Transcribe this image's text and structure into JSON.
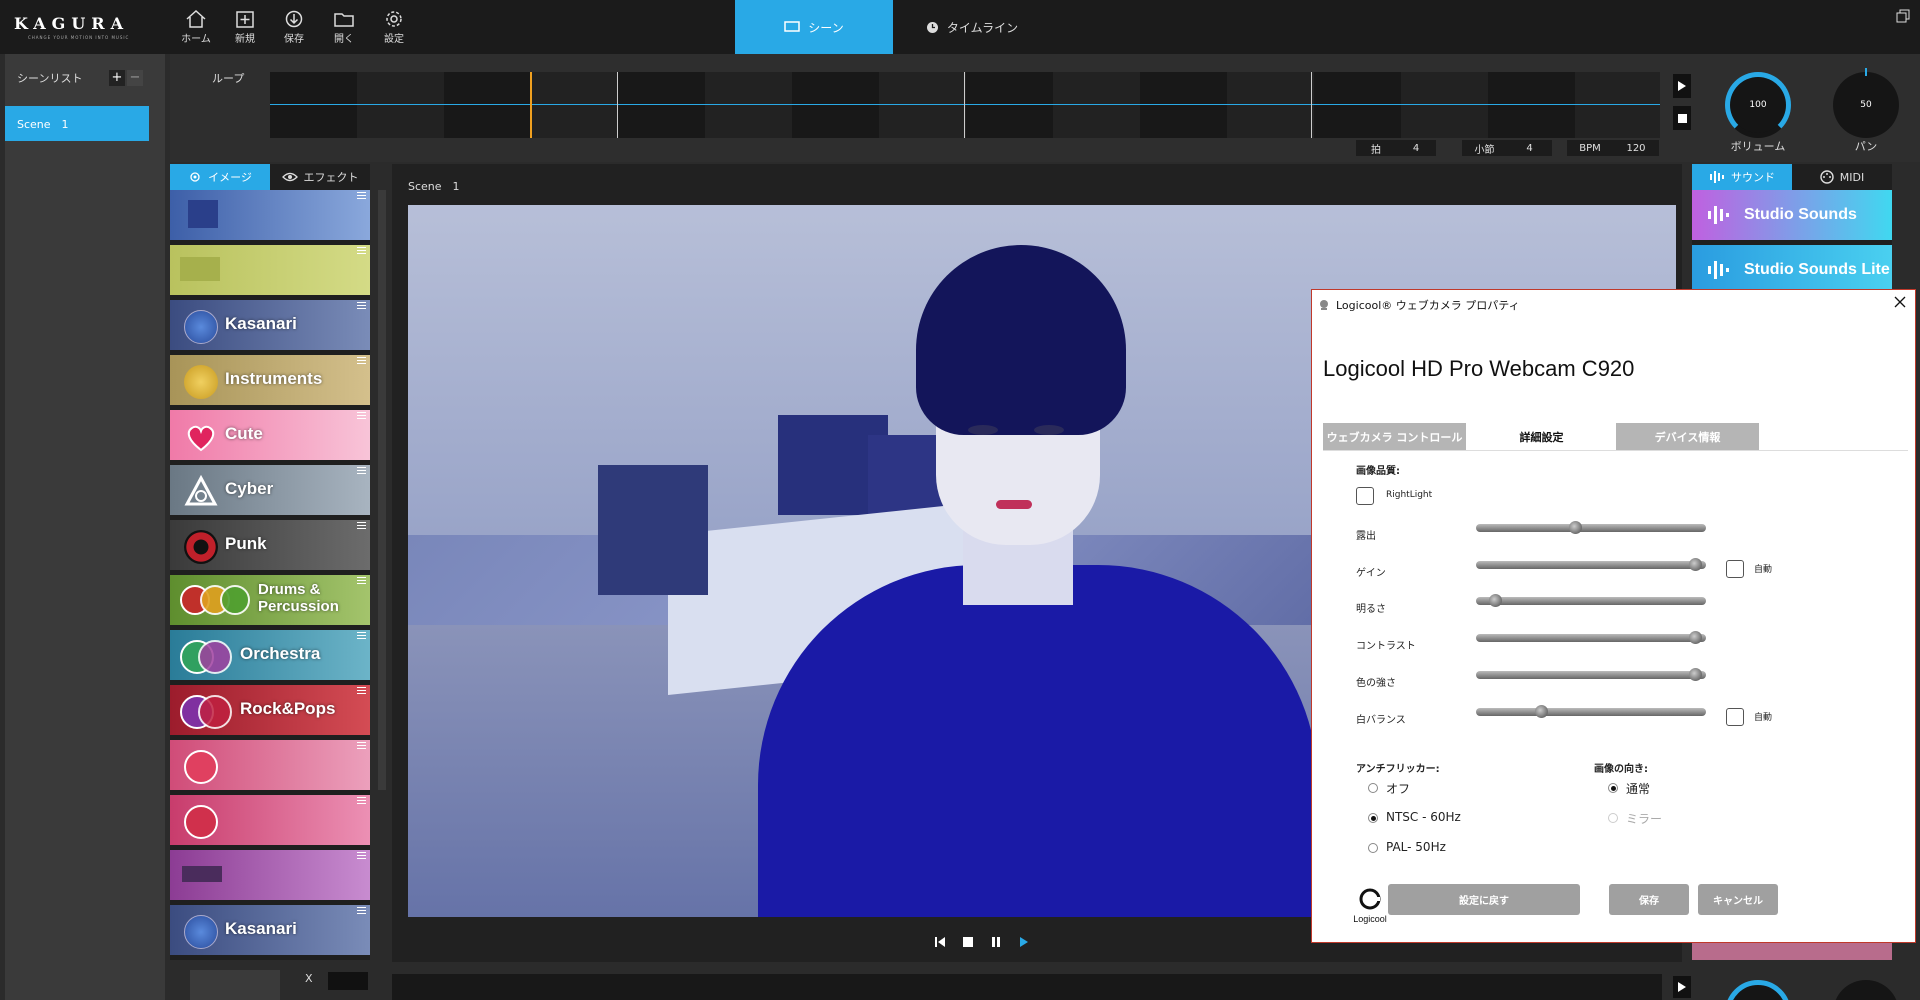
{
  "app": {
    "logo_text": "KAGURA",
    "logo_tagline": "CHANGE YOUR MOTION INTO MUSIC",
    "toolbar": [
      {
        "label": "ホーム",
        "icon": "home-icon"
      },
      {
        "label": "新規",
        "icon": "new-icon"
      },
      {
        "label": "保存",
        "icon": "save-icon"
      },
      {
        "label": "開く",
        "icon": "folder-icon"
      },
      {
        "label": "設定",
        "icon": "gear-icon"
      }
    ],
    "tabs": {
      "scene": "シーン",
      "timeline": "タイムライン"
    },
    "accent": "#29a9e6"
  },
  "scenelist": {
    "title": "シーンリスト",
    "items": [
      "Scene　1"
    ]
  },
  "loop": {
    "label": "ループ",
    "beat_label": "拍",
    "beat_value": "4",
    "measure_label": "小節",
    "measure_value": "4",
    "bpm_label": "BPM",
    "bpm_value": "120"
  },
  "knobs": {
    "volume_value": "100",
    "volume_label": "ボリューム",
    "volume_level": 1.0,
    "pan_value": "50",
    "pan_label": "パン",
    "pan_level": 0.5
  },
  "imagetabs": {
    "image": "イメージ",
    "effect": "エフェクト"
  },
  "image_tiles": [
    {
      "label": "",
      "bg": "#5a80c6"
    },
    {
      "label": "",
      "bg": "#b8c460"
    },
    {
      "label": "Kasanari",
      "bg": "#4a5a8c"
    },
    {
      "label": "Instruments",
      "bg": "#b8a46c"
    },
    {
      "label": "Cute",
      "bg": "#f4a2c0"
    },
    {
      "label": "Cyber",
      "bg": "#7c8894"
    },
    {
      "label": "Punk",
      "bg": "#4a4a4a"
    },
    {
      "label": "Drums &",
      "label2": "Percussion",
      "bg": "#7ca43c"
    },
    {
      "label": "Orchestra",
      "bg": "#3c8ca4"
    },
    {
      "label": "Rock&Pops",
      "bg": "#b02c34"
    },
    {
      "label": "",
      "bg": "#d85c84"
    },
    {
      "label": "",
      "bg": "#d8507c"
    },
    {
      "label": "",
      "bg": "#a458a4"
    },
    {
      "label": "Kasanari",
      "bg": "#4a5a8c"
    }
  ],
  "preview": {
    "scene_title": "Scene　1"
  },
  "soundtabs": {
    "sound": "サウンド",
    "midi": "MIDI"
  },
  "sound_tiles": [
    "Studio Sounds",
    "Studio Sounds Lite"
  ],
  "bottom": {
    "x_label": "X"
  },
  "dialog": {
    "title": "Logicool® ウェブカメラ プロパティ",
    "heading": "Logicool HD Pro Webcam C920",
    "tabs": [
      "ウェブカメラ コントロール",
      "詳細設定",
      "デバイス情報"
    ],
    "active_tab": "詳細設定",
    "quality_label": "画像品質:",
    "rightlight_label": "RightLight",
    "sliders": [
      {
        "label": "露出",
        "value": 0.43,
        "auto": false
      },
      {
        "label": "ゲイン",
        "value": 0.98,
        "auto": true
      },
      {
        "label": "明るさ",
        "value": 0.06,
        "auto": false
      },
      {
        "label": "コントラスト",
        "value": 0.98,
        "auto": false
      },
      {
        "label": "色の強さ",
        "value": 0.98,
        "auto": false
      },
      {
        "label": "白バランス",
        "value": 0.27,
        "auto": true
      }
    ],
    "auto_label": "自動",
    "antiflicker_label": "アンチフリッカー:",
    "antiflicker_options": [
      "オフ",
      "NTSC - 60Hz",
      "PAL- 50Hz"
    ],
    "antiflicker_selected": "NTSC - 60Hz",
    "orientation_label": "画像の向き:",
    "orientation_options": [
      "通常",
      "ミラー"
    ],
    "orientation_selected": "通常",
    "logo_text": "Logicool",
    "buttons": {
      "reset": "設定に戻す",
      "save": "保存",
      "cancel": "キャンセル"
    }
  }
}
